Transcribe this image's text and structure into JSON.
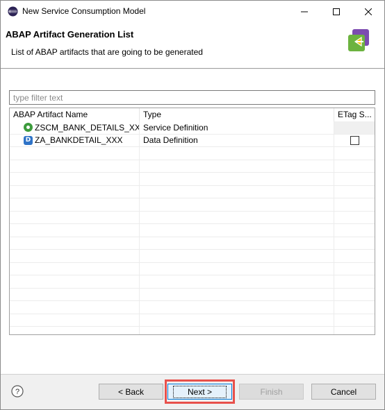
{
  "window": {
    "title": "New Service Consumption Model"
  },
  "banner": {
    "title": "ABAP Artifact Generation List",
    "description": "List of ABAP artifacts that are going to be generated"
  },
  "filter": {
    "placeholder": "type filter text",
    "value": ""
  },
  "table": {
    "columns": [
      "ABAP Artifact Name",
      "Type",
      "ETag S..."
    ],
    "rows": [
      {
        "name": "ZSCM_BANK_DETAILS_XXX",
        "type": "Service Definition",
        "icon": "service-definition-icon",
        "etag_checkbox": false
      },
      {
        "name": "ZA_BANKDETAIL_XXX",
        "type": "Data Definition",
        "icon": "data-definition-icon",
        "etag_checkbox": true,
        "etag_checked": false
      }
    ]
  },
  "buttons": {
    "back": "< Back",
    "next": "Next >",
    "finish": "Finish",
    "cancel": "Cancel"
  },
  "colors": {
    "highlight": "#e8504b",
    "default_button_border": "#0078d7"
  }
}
